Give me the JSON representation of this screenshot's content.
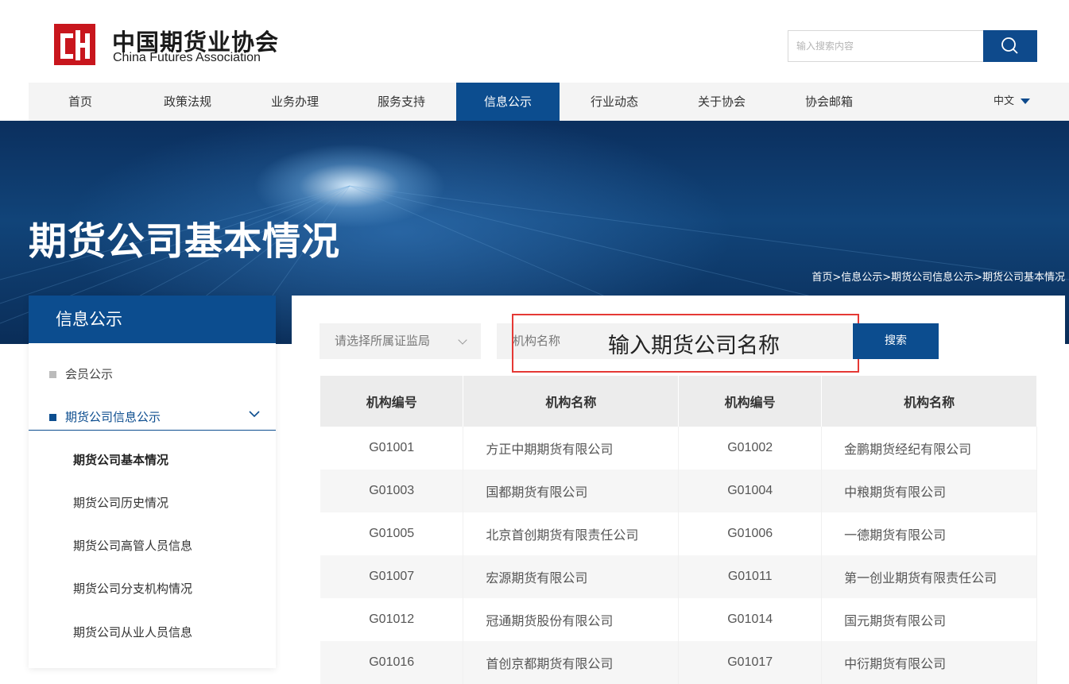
{
  "brand": {
    "name_cn": "中国期货业协会",
    "name_en": "China Futures Association",
    "logo_icon": "cfa-logo-icon"
  },
  "search": {
    "placeholder": "输入搜索内容",
    "button_icon": "search-icon"
  },
  "nav": {
    "items": [
      {
        "label": "首页"
      },
      {
        "label": "政策法规"
      },
      {
        "label": "业务办理"
      },
      {
        "label": "服务支持"
      },
      {
        "label": "信息公示",
        "active": true
      },
      {
        "label": "行业动态"
      },
      {
        "label": "关于协会"
      },
      {
        "label": "协会邮箱"
      }
    ],
    "language": "中文"
  },
  "banner": {
    "title": "期货公司基本情况",
    "breadcrumb": "首页>信息公示>期货公司信息公示>期货公司基本情况"
  },
  "sidebar": {
    "title": "信息公示",
    "items": [
      {
        "label": "会员公示"
      },
      {
        "label": "期货公司信息公示",
        "expanded": true
      }
    ],
    "subitems": [
      {
        "label": "期货公司基本情况",
        "active": true
      },
      {
        "label": "期货公司历史情况"
      },
      {
        "label": "期货公司高管人员信息"
      },
      {
        "label": "期货公司分支机构情况"
      },
      {
        "label": "期货公司从业人员信息"
      }
    ]
  },
  "filters": {
    "regulator_select": "请选择所属证监局",
    "field_select": "机构名称",
    "name_input_value": "输入期货公司名称",
    "search_button": "搜索"
  },
  "colors": {
    "brand_blue": "#0c4d8f",
    "logo_red": "#c8161d",
    "annotation_red": "#e53935"
  },
  "table": {
    "headers": [
      "机构编号",
      "机构名称",
      "机构编号",
      "机构名称"
    ],
    "rows": [
      [
        "G01001",
        "方正中期期货有限公司",
        "G01002",
        "金鹏期货经纪有限公司"
      ],
      [
        "G01003",
        "国都期货有限公司",
        "G01004",
        "中粮期货有限公司"
      ],
      [
        "G01005",
        "北京首创期货有限责任公司",
        "G01006",
        "一德期货有限公司"
      ],
      [
        "G01007",
        "宏源期货有限公司",
        "G01011",
        "第一创业期货有限责任公司"
      ],
      [
        "G01012",
        "冠通期货股份有限公司",
        "G01014",
        "国元期货有限公司"
      ],
      [
        "G01016",
        "首创京都期货有限公司",
        "G01017",
        "中衍期货有限公司"
      ]
    ]
  }
}
